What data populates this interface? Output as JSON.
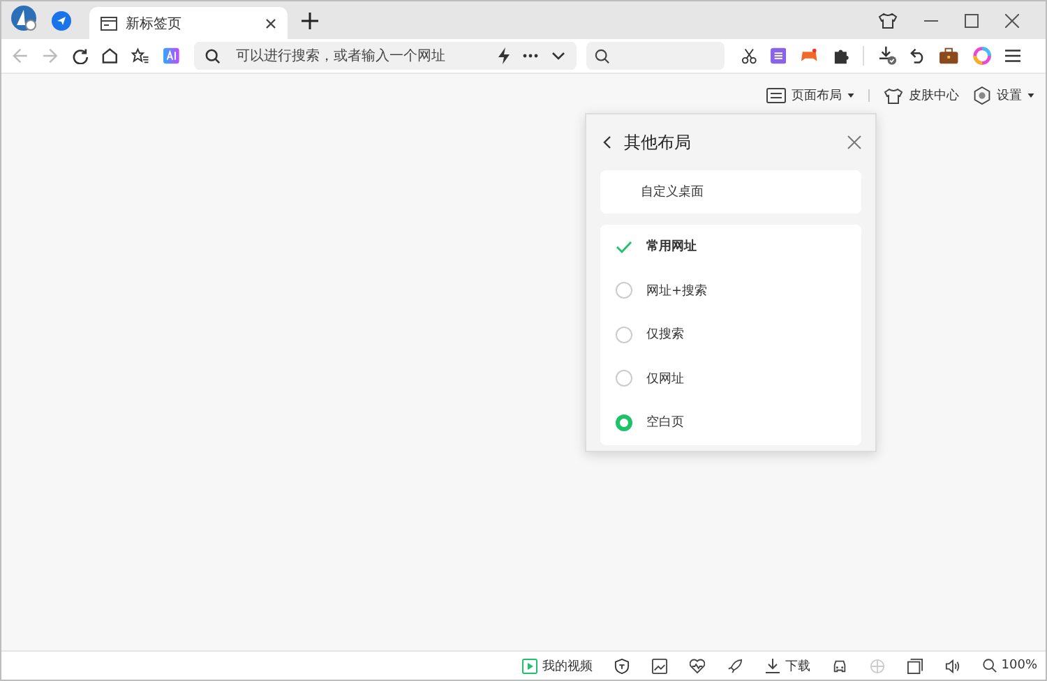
{
  "tab": {
    "title": "新标签页",
    "selected": true
  },
  "address": {
    "placeholder": "可以进行搜索，或者输入一个网址"
  },
  "page_menu": {
    "layout": "页面布局",
    "skin": "皮肤中心",
    "settings": "设置"
  },
  "panel": {
    "title": "其他布局",
    "custom": "自定义桌面",
    "options": [
      {
        "label": "常用网址",
        "kind": "check",
        "selected": true
      },
      {
        "label": "网址+搜索",
        "kind": "radio",
        "selected": false
      },
      {
        "label": "仅搜索",
        "kind": "radio",
        "selected": false
      },
      {
        "label": "仅网址",
        "kind": "radio",
        "selected": false
      },
      {
        "label": "空白页",
        "kind": "radio",
        "selected": true
      }
    ]
  },
  "status_bar": {
    "video": "我的视频",
    "download": "下载",
    "zoom": "100%"
  }
}
